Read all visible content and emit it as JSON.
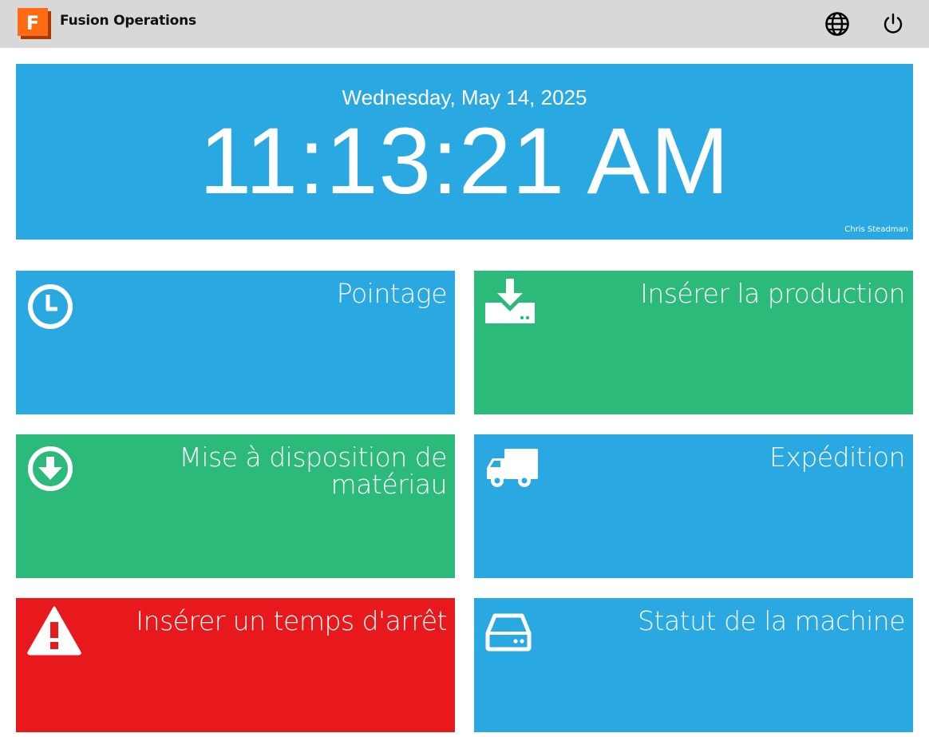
{
  "header": {
    "app_title": "Fusion Operations",
    "logo_letter": "F",
    "icons": {
      "language": "globe-icon",
      "logout": "power-icon"
    }
  },
  "clock": {
    "date": "Wednesday, May 14, 2025",
    "time": "11:13:21 AM",
    "user": "Chris Steadman"
  },
  "tiles": [
    {
      "label": "Pointage",
      "icon": "clock-icon",
      "color": "#29a8e2"
    },
    {
      "label": "Insérer la production",
      "icon": "download-tray-icon",
      "color": "#2bba7a"
    },
    {
      "label": "Mise à disposition de matériau",
      "icon": "arrow-down-circle-icon",
      "color": "#2bba7a"
    },
    {
      "label": "Expédition",
      "icon": "truck-icon",
      "color": "#29a8e2"
    },
    {
      "label": "Insérer un temps d'arrêt",
      "icon": "warning-icon",
      "color": "#e8191c"
    },
    {
      "label": "Statut de la machine",
      "icon": "hard-drive-icon",
      "color": "#29a8e2"
    }
  ],
  "colors": {
    "topbar": "#d8d8d8",
    "blue": "#29a8e2",
    "green": "#2bba7a",
    "red": "#e8191c",
    "logo_orange": "#ff6a13"
  }
}
